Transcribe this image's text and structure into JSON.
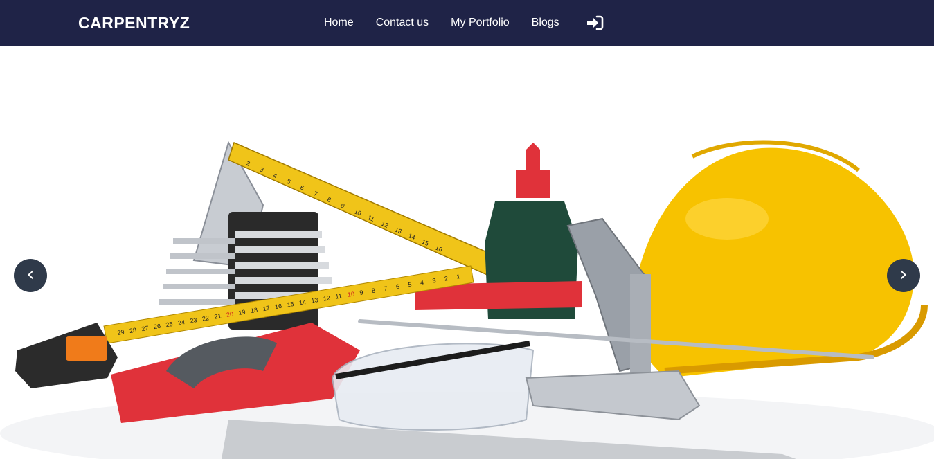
{
  "navbar": {
    "brand": "CARPENTRYZ",
    "links": [
      {
        "label": "Home"
      },
      {
        "label": "Contact us"
      },
      {
        "label": "My Portfolio"
      },
      {
        "label": "Blogs"
      }
    ],
    "login_icon": "sign-in-icon"
  },
  "hero": {
    "image": "carpentry-tools-photo",
    "prev_label": "‹",
    "next_label": "›"
  },
  "colors": {
    "navbar_bg": "#1f2347",
    "helmet": "#f7c200",
    "tape_yellow": "#f0c419",
    "saw_red": "#e0323a",
    "bottle_green": "#1f4a3a"
  },
  "tape_marks": [
    "29",
    "28",
    "27",
    "26",
    "25",
    "24",
    "23",
    "22",
    "21",
    "20",
    "19",
    "18",
    "17",
    "16",
    "15",
    "14",
    "13",
    "12",
    "11",
    "10",
    "9",
    "8",
    "7",
    "6",
    "5",
    "4",
    "3",
    "2",
    "1"
  ],
  "ruler_marks": [
    "2",
    "3",
    "4",
    "5",
    "6",
    "7",
    "8",
    "9",
    "10",
    "11",
    "12",
    "13",
    "14",
    "15",
    "16"
  ]
}
